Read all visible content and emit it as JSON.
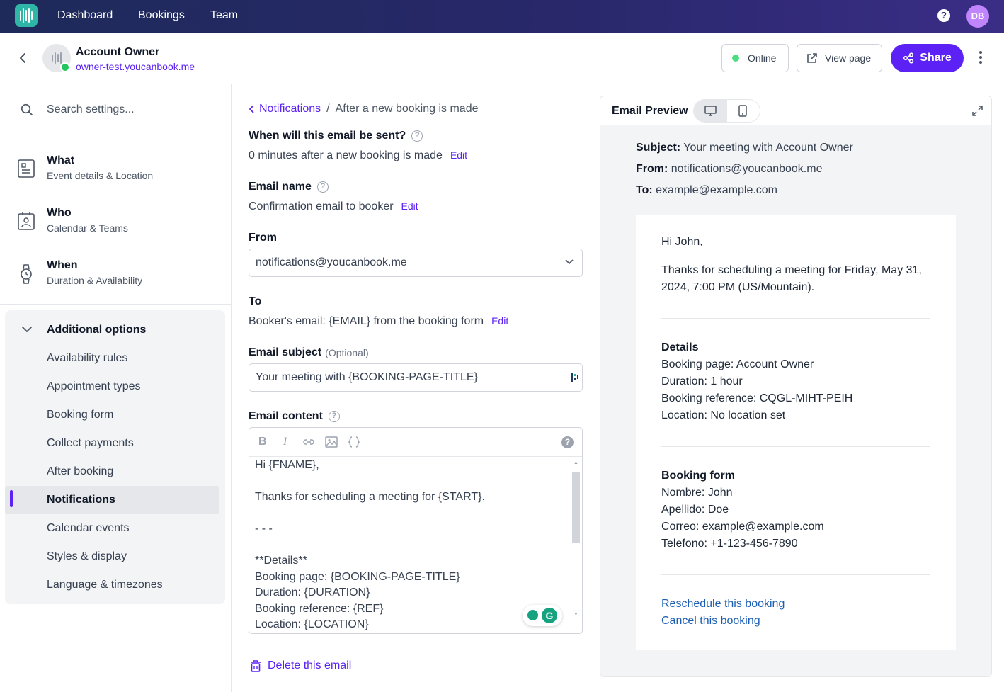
{
  "topnav": {
    "items": [
      "Dashboard",
      "Bookings",
      "Team"
    ],
    "avatar_initials": "DB",
    "help_symbol": "?"
  },
  "header": {
    "account_name": "Account Owner",
    "account_url": "owner-test.youcanbook.me",
    "online_label": "Online",
    "view_page_label": "View page",
    "share_label": "Share"
  },
  "sidebar": {
    "search_placeholder": "Search settings...",
    "main_items": [
      {
        "title": "What",
        "subtitle": "Event details & Location",
        "icon": "document-icon"
      },
      {
        "title": "Who",
        "subtitle": "Calendar & Teams",
        "icon": "contact-card-icon"
      },
      {
        "title": "When",
        "subtitle": "Duration & Availability",
        "icon": "watch-icon"
      }
    ],
    "additional_options": {
      "title": "Additional options",
      "items": [
        "Availability rules",
        "Appointment types",
        "Booking form",
        "Collect payments",
        "After booking",
        "Notifications",
        "Calendar events",
        "Styles & display",
        "Language & timezones"
      ],
      "active": "Notifications"
    }
  },
  "editor": {
    "breadcrumb": {
      "parent": "Notifications",
      "separator": "/",
      "current": "After a new booking is made"
    },
    "when_label": "When will this email be sent?",
    "when_value": "0 minutes after a new booking is made",
    "name_label": "Email name",
    "name_value": "Confirmation email to booker",
    "from_label": "From",
    "from_value": "notifications@youcanbook.me",
    "to_label": "To",
    "to_value": "Booker's email: {EMAIL} from the booking form",
    "subject_label": "Email subject",
    "subject_optional": "(Optional)",
    "subject_value": "Your meeting with {BOOKING-PAGE-TITLE}",
    "content_label": "Email content",
    "edit_label": "Edit",
    "toolbar": {
      "bold": "B",
      "italic": "I",
      "help": "?"
    },
    "content_value": "Hi {FNAME},\n\nThanks for scheduling a meeting for {START}.\n\n- - -\n\n**Details**\nBooking page: {BOOKING-PAGE-TITLE}\nDuration: {DURATION}\nBooking reference: {REF}\nLocation: {LOCATION}",
    "delete_label": "Delete this email"
  },
  "preview": {
    "title": "Email Preview",
    "subject_key": "Subject:",
    "subject_value": "Your meeting with Account Owner",
    "from_key": "From:",
    "from_value": "notifications@youcanbook.me",
    "to_key": "To:",
    "to_value": "example@example.com",
    "greeting": "Hi John,",
    "intro_line1": "Thanks for scheduling a meeting for Friday, May 31,",
    "intro_line2": "2024, 7:00 PM (US/Mountain).",
    "details_title": "Details",
    "details": [
      "Booking page: Account Owner",
      "Duration: 1 hour",
      "Booking reference: CQGL-MIHT-PEIH",
      "Location: No location set"
    ],
    "form_title": "Booking form",
    "form": [
      "Nombre: John",
      "Apellido: Doe",
      "Correo: example@example.com",
      "Telefono: +1-123-456-7890"
    ],
    "reschedule_link": "Reschedule this booking",
    "cancel_link": "Cancel this booking"
  },
  "colors": {
    "accent": "#5b21f5",
    "nav_bg": "#28286a",
    "online": "#22c55e",
    "brand_logo": "#2fb6a6"
  }
}
